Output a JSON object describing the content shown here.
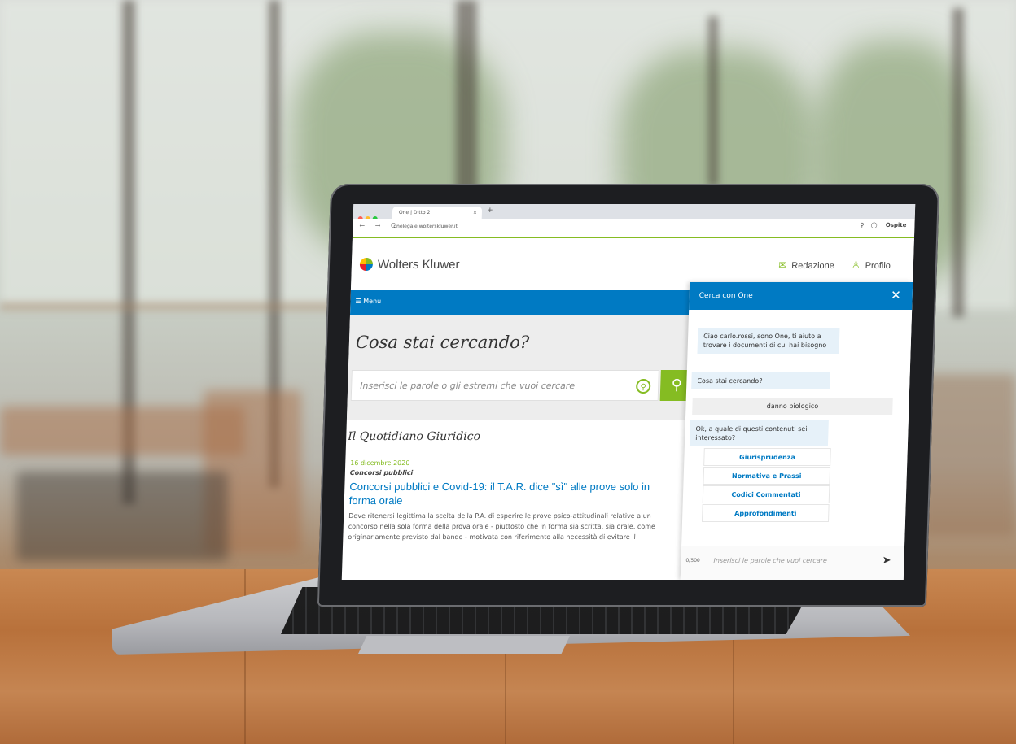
{
  "browser": {
    "tab_title": "One | Ditto 2",
    "url": "onelegale.wolterskluwer.it",
    "nav_glyphs": "← → C",
    "ospite": "Ospite"
  },
  "header": {
    "logo": "Wolters Kluwer",
    "redazione": "Redazione",
    "profilo": "Profilo"
  },
  "menu": {
    "label": "☰ Menu"
  },
  "search": {
    "title": "Cosa stai cercando?",
    "placeholder": "Inserisci le parole o gli estremi che vuoi cercare"
  },
  "news": {
    "section_title": "Il Quotidiano Giuridico",
    "date": "16 dicembre 2020",
    "category": "Concorsi pubblici",
    "headline": "Concorsi pubblici e Covid-19: il T.A.R. dice \"sì\" alle prove solo in forma orale",
    "body": "Deve ritenersi legittima la scelta della P.A. di esperire le prove psico-attitudinali relative a un concorso nella sola forma della prova orale - piuttosto che in forma sia scritta, sia orale, come originariamente previsto dal bando - motivata con riferimento alla necessità di evitare il"
  },
  "chat": {
    "title": "Cerca con One",
    "greeting": "Ciao carlo.rossi, sono One, ti aiuto a trovare i documenti di cui hai bisogno",
    "question": "Cosa stai cercando?",
    "user_reply": "danno biologico",
    "followup": "Ok, a quale di questi contenuti sei interessato?",
    "options": [
      "Giurisprudenza",
      "Normativa e Prassi",
      "Codici Commentati",
      "Approfondimenti"
    ],
    "counter": "0/500",
    "input_placeholder": "Inserisci le parole che vuoi cercare"
  },
  "colors": {
    "brand_blue": "#007ac3",
    "brand_green": "#85bc22"
  }
}
